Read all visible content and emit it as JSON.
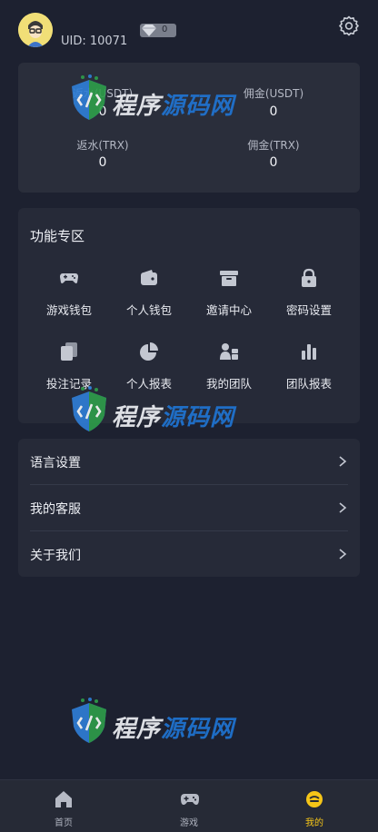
{
  "header": {
    "uid": "UID: 10071",
    "vip_level": "0"
  },
  "stats": {
    "items": [
      {
        "label": "返水(USDT)",
        "value": "0"
      },
      {
        "label": "佣金(USDT)",
        "value": "0"
      },
      {
        "label": "返水(TRX)",
        "value": "0"
      },
      {
        "label": "佣金(TRX)",
        "value": "0"
      }
    ]
  },
  "functions": {
    "title": "功能专区",
    "items": [
      {
        "label": "游戏钱包",
        "icon": "gamepad-icon"
      },
      {
        "label": "个人钱包",
        "icon": "wallet-icon"
      },
      {
        "label": "邀请中心",
        "icon": "archive-box-icon"
      },
      {
        "label": "密码设置",
        "icon": "lock-icon"
      },
      {
        "label": "投注记录",
        "icon": "copy-records-icon"
      },
      {
        "label": "个人报表",
        "icon": "pie-chart-icon"
      },
      {
        "label": "我的团队",
        "icon": "team-icon"
      },
      {
        "label": "团队报表",
        "icon": "bar-chart-icon"
      }
    ]
  },
  "menu": {
    "items": [
      {
        "label": "语言设置"
      },
      {
        "label": "我的客服"
      },
      {
        "label": "关于我们"
      }
    ]
  },
  "tabbar": {
    "items": [
      {
        "label": "首页",
        "icon": "home-icon",
        "active": false
      },
      {
        "label": "游戏",
        "icon": "gamepad-icon",
        "active": false
      },
      {
        "label": "我的",
        "icon": "smiley-icon",
        "active": true
      }
    ]
  },
  "watermark": {
    "text_part1": "程序",
    "text_part2": "源码网"
  },
  "colors": {
    "background": "#1d2130",
    "card": "#262a38",
    "accent": "#f5c518",
    "watermark_blue": "#1f76d6"
  }
}
